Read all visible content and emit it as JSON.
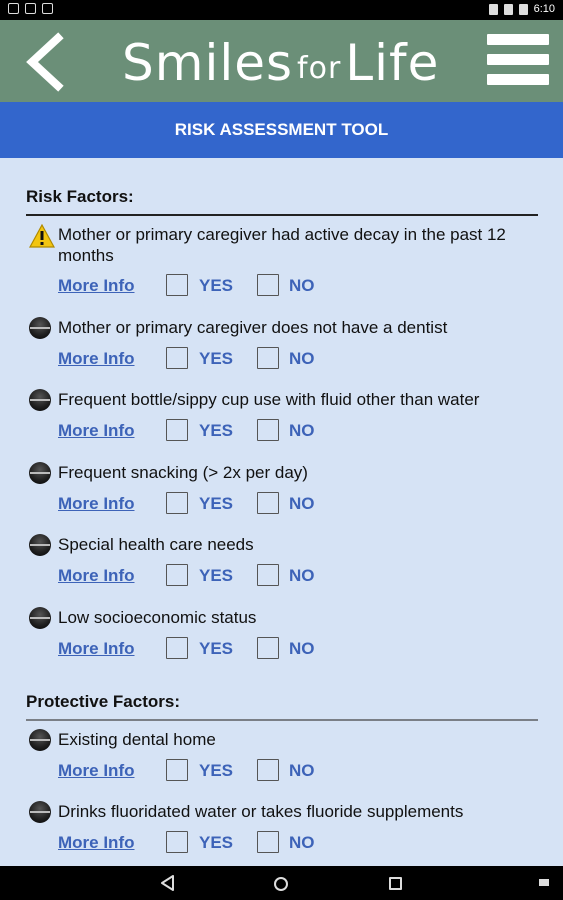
{
  "status_bar": {
    "time": "6:10"
  },
  "header": {
    "logo_part1": "Smiles",
    "logo_part2": "for",
    "logo_part3": "Life"
  },
  "title_bar": {
    "title": "RISK ASSESSMENT TOOL"
  },
  "common": {
    "more_info": "More Info",
    "yes": "YES",
    "no": "NO"
  },
  "risk_factors": {
    "heading": "Risk Factors:",
    "items": [
      {
        "text": "Mother or primary caregiver had active decay in the past 12 months",
        "icon": "warning-icon"
      },
      {
        "text": "Mother or primary caregiver does not have a dentist",
        "icon": "dot-icon"
      },
      {
        "text": "Frequent bottle/sippy cup use with fluid other than water",
        "icon": "dot-icon"
      },
      {
        "text": "Frequent snacking (> 2x per day)",
        "icon": "dot-icon"
      },
      {
        "text": "Special health care needs",
        "icon": "dot-icon"
      },
      {
        "text": "Low socioeconomic status",
        "icon": "dot-icon"
      }
    ]
  },
  "protective_factors": {
    "heading": "Protective Factors:",
    "items": [
      {
        "text": "Existing dental home",
        "icon": "dot-icon"
      },
      {
        "text": "Drinks fluoridated water or takes fluoride supplements",
        "icon": "dot-icon"
      }
    ]
  }
}
